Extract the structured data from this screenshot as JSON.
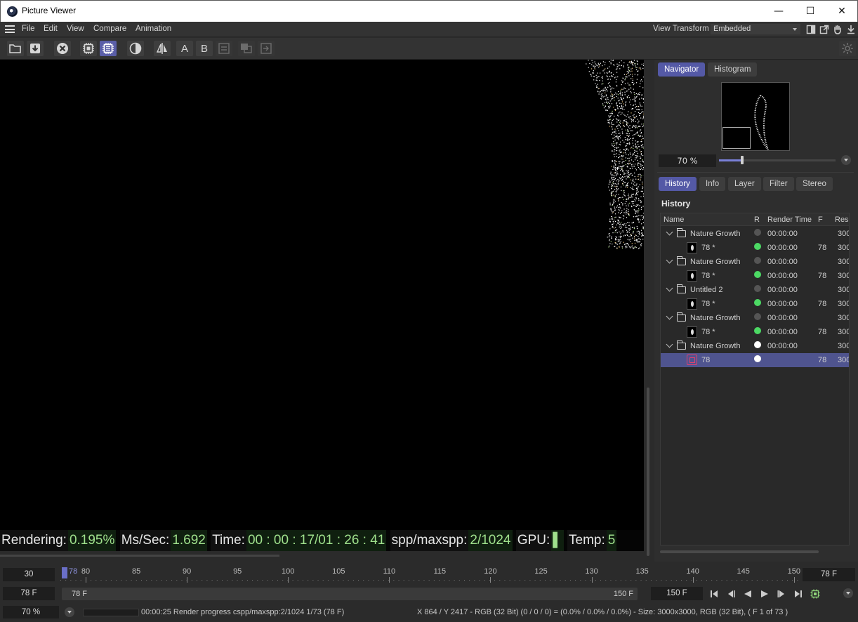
{
  "window": {
    "title": "Picture Viewer",
    "controls": {
      "minimize": "—",
      "maximize": "☐",
      "close": "✕"
    }
  },
  "menu": {
    "items": [
      "File",
      "Edit",
      "View",
      "Compare",
      "Animation"
    ],
    "view_transform_label": "View Transform",
    "view_transform_value": "Embedded"
  },
  "toolbar": {
    "text_buttons": {
      "a": "A",
      "b": "B"
    }
  },
  "hud": {
    "rendering_label": "Rendering:",
    "rendering_value": "0.195%",
    "ms_label": "Ms/Sec:",
    "ms_value": "1.692",
    "time_label": "Time:",
    "time_value": "00 : 00 : 17/01 : 26 : 41",
    "spp_label": "spp/maxspp:",
    "spp_value": "2/1024",
    "gpu_label": "GPU:",
    "gpu_value": "▌",
    "temp_label": "Temp:",
    "temp_value": "5"
  },
  "panel": {
    "top_tabs": [
      "Navigator",
      "Histogram"
    ],
    "zoom": "70 %",
    "zoom_fraction": 0.2,
    "bottom_tabs": [
      "History",
      "Info",
      "Layer",
      "Filter",
      "Stereo"
    ],
    "history_title": "History",
    "columns": [
      "Name",
      "R",
      "Render Time",
      "F",
      "Reso"
    ],
    "rows": [
      {
        "kind": "folder",
        "name": "Nature Growth",
        "status": "gray",
        "time": "00:00:00",
        "frame": "",
        "res": "300"
      },
      {
        "kind": "image",
        "name": "78 *",
        "status": "green",
        "time": "00:00:00",
        "frame": "78",
        "res": "300"
      },
      {
        "kind": "folder",
        "name": "Nature Growth",
        "status": "gray",
        "time": "00:00:00",
        "frame": "",
        "res": "300"
      },
      {
        "kind": "image",
        "name": "78 *",
        "status": "green",
        "time": "00:00:00",
        "frame": "78",
        "res": "300"
      },
      {
        "kind": "folder",
        "name": "Untitled 2",
        "status": "gray",
        "time": "00:00:00",
        "frame": "",
        "res": "300"
      },
      {
        "kind": "image",
        "name": "78 *",
        "status": "green",
        "time": "00:00:00",
        "frame": "78",
        "res": "300"
      },
      {
        "kind": "folder",
        "name": "Nature Growth",
        "status": "gray",
        "time": "00:00:00",
        "frame": "",
        "res": "300"
      },
      {
        "kind": "image",
        "name": "78 *",
        "status": "green",
        "time": "00:00:00",
        "frame": "78",
        "res": "300"
      },
      {
        "kind": "folder",
        "name": "Nature Growth",
        "status": "white",
        "time": "00:00:00",
        "frame": "",
        "res": "300"
      },
      {
        "kind": "render",
        "name": "78",
        "status": "white",
        "time": "",
        "frame": "78",
        "res": "300",
        "selected": true
      }
    ]
  },
  "timeline": {
    "start_field": "30",
    "end_field": "78 F",
    "current_marker": "78",
    "ticks": [
      "80",
      "85",
      "90",
      "95",
      "100",
      "105",
      "110",
      "115",
      "120",
      "125",
      "130",
      "135",
      "140",
      "145",
      "150"
    ],
    "range_start_field": "78 F",
    "range_bar_start": "78 F",
    "range_bar_end": "150 F",
    "range_end_field": "150 F"
  },
  "status": {
    "zoom": "70 %",
    "render_info": "00:00:25 Render progress  cspp/maxspp:2/1024 1/73 (78 F)",
    "pixel_info": "X 864 / Y 2417 - RGB (32 Bit) (0 / 0 / 0) = (0.0% / 0.0% / 0.0%) - Size: 3000x3000, RGB (32 Bit),  ( F 1 of 73 )"
  },
  "colors": {
    "accent": "#5459a6",
    "status_green": "#4cd964",
    "status_gray": "#555555",
    "status_white": "#ffffff",
    "hud_value": "#9fe08c"
  }
}
